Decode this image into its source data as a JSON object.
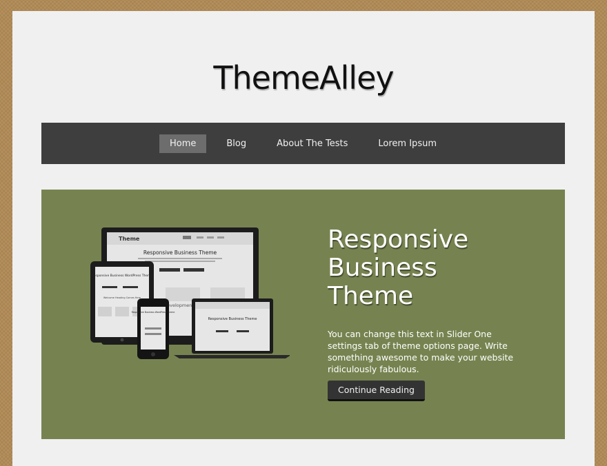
{
  "site": {
    "title": "ThemeAlley"
  },
  "nav": {
    "items": [
      {
        "label": "Home",
        "active": true
      },
      {
        "label": "Blog"
      },
      {
        "label": "About The Tests"
      },
      {
        "label": "Lorem Ipsum"
      }
    ]
  },
  "slider": {
    "title_lines": [
      "Responsive",
      "Business",
      "Theme"
    ],
    "text": "You can change this text in Slider One settings tab of theme options page. Write something awesome to make your website ridiculously fabulous.",
    "button_label": "Continue Reading",
    "mockup": {
      "brand": "Theme",
      "heading": "Responsive Business Theme",
      "tablet_heading": "Responsive Business WordPress Theme",
      "phone_heading": "Responsive Business WordPress Theme",
      "section_label": "development",
      "tablet_sub": "Welcome Heading Comes Here"
    }
  },
  "colors": {
    "background": "#b08a55",
    "page": "#f0f0f1",
    "nav": "#3e3e3e",
    "nav_active": "#6d6d6d",
    "slider": "#768350",
    "button": "#333334"
  }
}
